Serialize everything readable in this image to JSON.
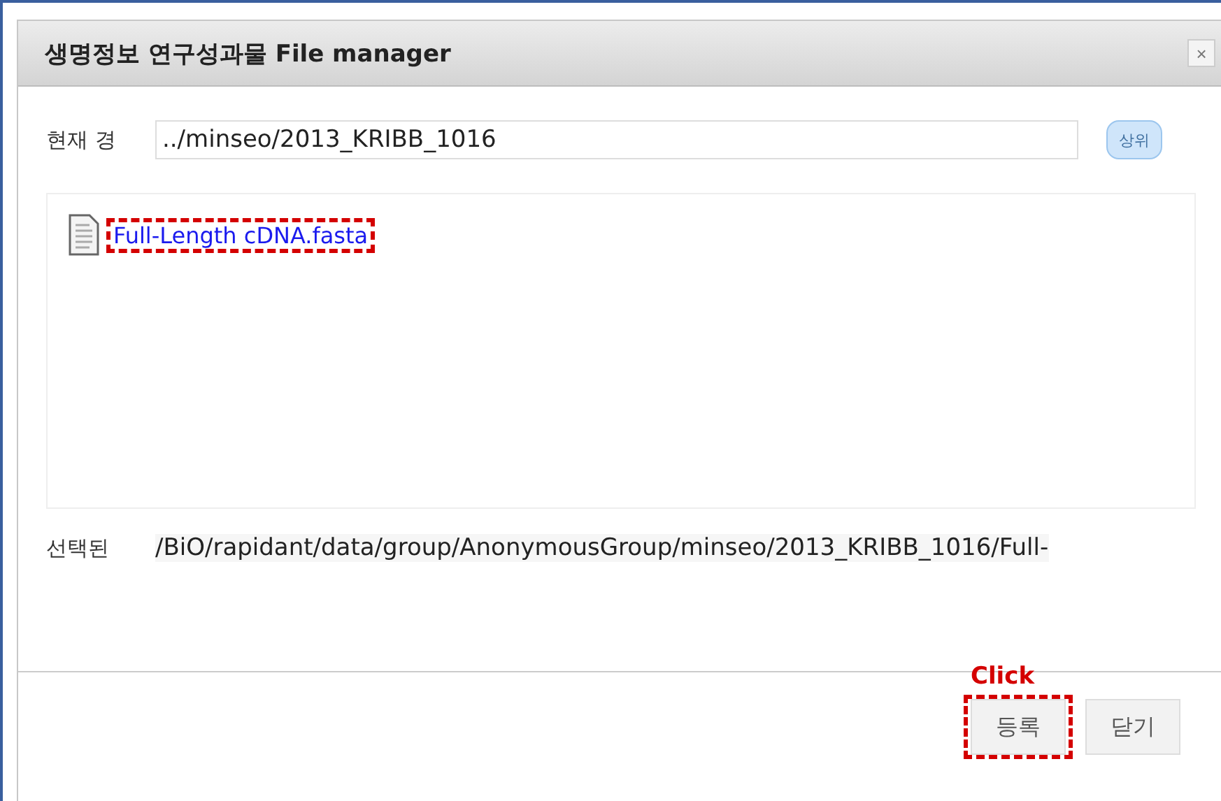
{
  "dialog": {
    "title": "생명정보 연구성과물 File manager",
    "close": "×"
  },
  "path": {
    "label": "현재 경",
    "value": "../minseo/2013_KRIBB_1016",
    "button": "상위"
  },
  "files": [
    {
      "name": "Full-Length cDNA.fasta",
      "highlighted": true
    }
  ],
  "selected": {
    "label": "선택된",
    "value": "/BiO/rapidant/data/group/AnonymousGroup/minseo/2013_KRIBB_1016/Full-"
  },
  "buttons": [
    {
      "label": "등록",
      "highlighted": true
    },
    {
      "label": "닫기",
      "highlighted": false
    }
  ],
  "annotation": {
    "text": "Click"
  }
}
